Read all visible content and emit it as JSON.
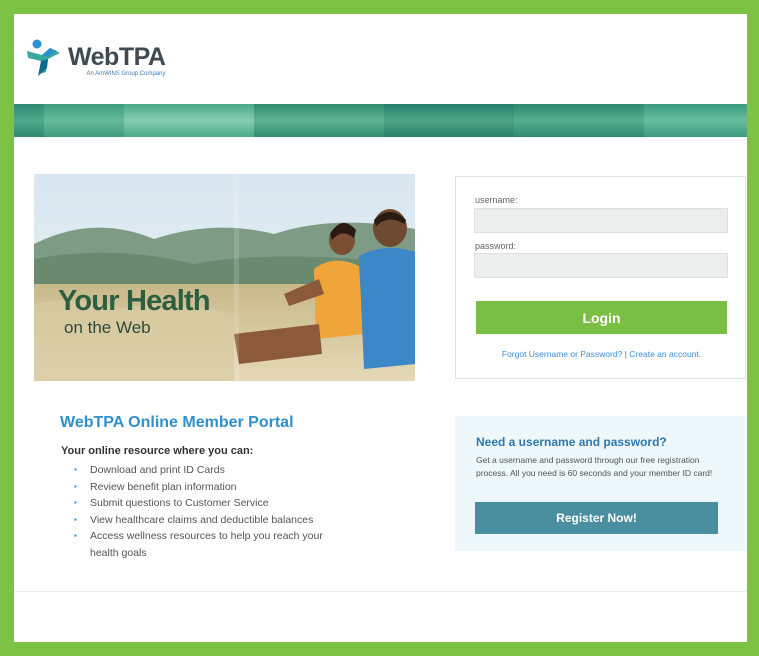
{
  "brand": {
    "name": "WebTPA",
    "tagline": "An AmWINS Group Company",
    "frame_color": "#7dc242"
  },
  "hero": {
    "title": "Your Health",
    "subtitle": "on the Web"
  },
  "login": {
    "username_label": "username:",
    "password_label": "password:",
    "username_value": "",
    "password_value": "",
    "button_label": "Login",
    "forgot_link": "Forgot Username or Password?",
    "separator": "|",
    "create_link": "Create an account."
  },
  "portal": {
    "title": "WebTPA Online Member Portal",
    "intro": "Your online resource where you can:",
    "items": [
      "Download and print ID Cards",
      "Review benefit plan information",
      "Submit questions to Customer Service",
      "View healthcare claims and deductible balances",
      "Access wellness resources to help you reach your health goals"
    ]
  },
  "register": {
    "title": "Need a username and password?",
    "text": "Get a username and password through our free registration process. All you need is 60 seconds and your member ID card!",
    "button_label": "Register Now!"
  },
  "colors": {
    "accent_green": "#79bf43",
    "link_blue": "#3d8ed8",
    "register_button": "#4b8ea0"
  }
}
